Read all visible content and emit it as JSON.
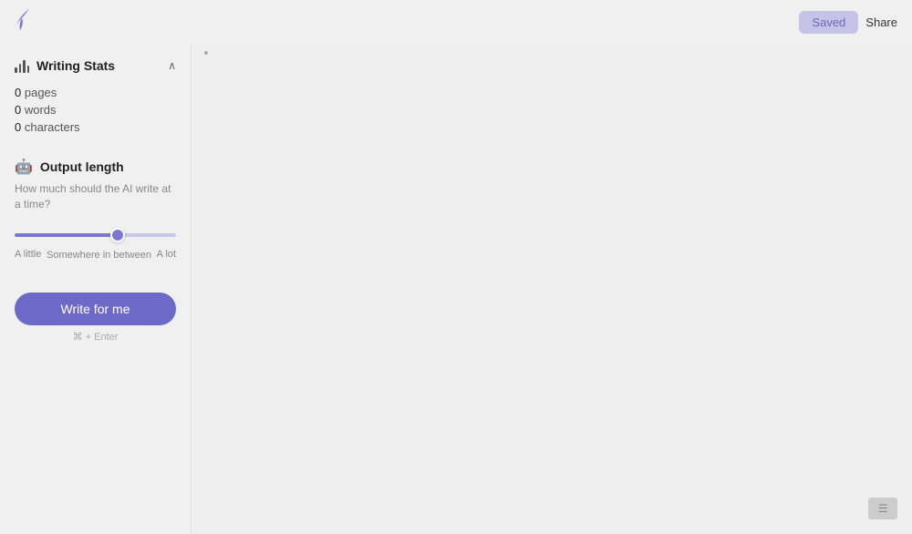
{
  "topbar": {
    "saved_label": "Saved",
    "share_label": "Share"
  },
  "sidebar": {
    "writing_stats": {
      "title": "Writing Stats",
      "pages_count": "0",
      "pages_label": "pages",
      "words_count": "0",
      "words_label": "words",
      "chars_count": "0",
      "chars_label": "characters"
    },
    "output_length": {
      "title": "Output length",
      "description": "How much should the AI write at a time?",
      "slider_min_label": "A little",
      "slider_mid_label": "Somewhere in between",
      "slider_max_label": "A lot",
      "slider_value": 65
    },
    "write_button": {
      "label": "Write for me",
      "shortcut": "⌘ + Enter"
    }
  },
  "main": {
    "dot": "·"
  }
}
